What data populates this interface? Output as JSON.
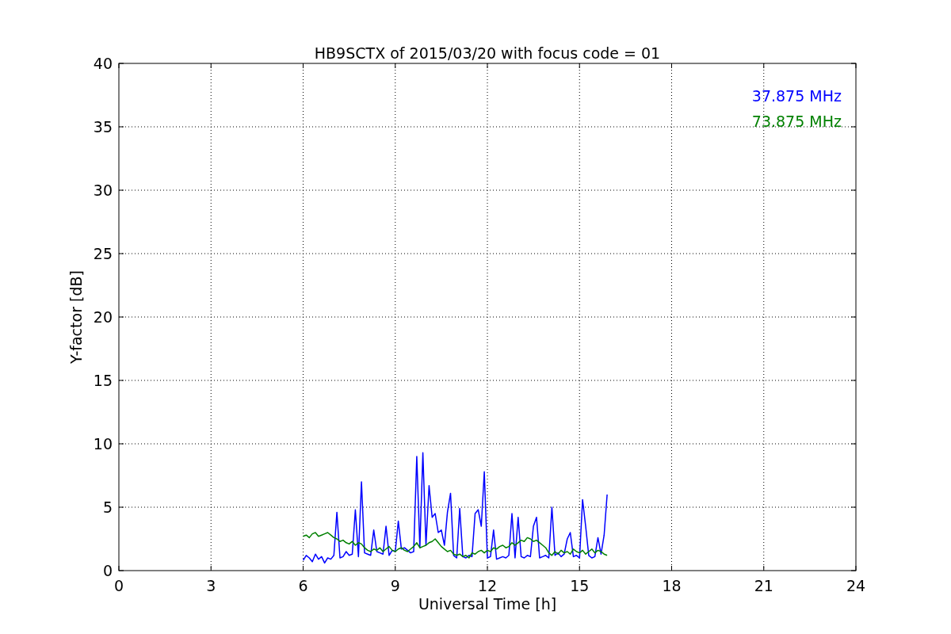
{
  "chart_data": {
    "type": "line",
    "grid": true,
    "title": "HB9SCTX of 2015/03/20 with focus code = 01",
    "xlabel": "Universal Time [h]",
    "ylabel": "Y-factor [dB]",
    "xlim": [
      0,
      24
    ],
    "ylim": [
      0,
      40
    ],
    "xticks": [
      0,
      3,
      6,
      9,
      12,
      15,
      18,
      21,
      24
    ],
    "yticks": [
      0,
      5,
      10,
      15,
      20,
      25,
      30,
      35,
      40
    ],
    "x": [
      6.0,
      6.1,
      6.2,
      6.3,
      6.4,
      6.5,
      6.6,
      6.7,
      6.8,
      6.9,
      7.0,
      7.1,
      7.2,
      7.3,
      7.4,
      7.5,
      7.6,
      7.7,
      7.8,
      7.9,
      8.0,
      8.1,
      8.2,
      8.3,
      8.4,
      8.5,
      8.6,
      8.7,
      8.8,
      8.9,
      9.0,
      9.1,
      9.2,
      9.3,
      9.4,
      9.5,
      9.6,
      9.7,
      9.8,
      9.9,
      10.0,
      10.1,
      10.2,
      10.3,
      10.4,
      10.5,
      10.6,
      10.7,
      10.8,
      10.9,
      11.0,
      11.1,
      11.2,
      11.3,
      11.4,
      11.5,
      11.6,
      11.7,
      11.8,
      11.9,
      12.0,
      12.1,
      12.2,
      12.3,
      12.4,
      12.5,
      12.6,
      12.7,
      12.8,
      12.9,
      13.0,
      13.1,
      13.2,
      13.3,
      13.4,
      13.5,
      13.6,
      13.7,
      13.8,
      13.9,
      14.0,
      14.1,
      14.2,
      14.3,
      14.4,
      14.5,
      14.6,
      14.7,
      14.8,
      14.9,
      15.0,
      15.1,
      15.2,
      15.3,
      15.4,
      15.5,
      15.6,
      15.7,
      15.8,
      15.9
    ],
    "series": [
      {
        "name": "37.875 MHz",
        "color": "#0000ff",
        "values": [
          0.8,
          1.2,
          1.0,
          0.7,
          1.3,
          0.9,
          1.1,
          0.6,
          1.0,
          0.9,
          1.2,
          4.6,
          1.0,
          1.1,
          1.5,
          1.2,
          1.3,
          4.8,
          1.1,
          7.0,
          1.4,
          1.3,
          1.2,
          3.2,
          1.5,
          1.4,
          1.3,
          3.5,
          1.2,
          1.6,
          1.5,
          3.9,
          1.7,
          1.8,
          1.6,
          1.4,
          1.5,
          9.0,
          1.8,
          9.3,
          2.0,
          6.7,
          4.2,
          4.5,
          3.0,
          3.2,
          2.0,
          4.6,
          6.1,
          1.2,
          1.0,
          4.9,
          1.1,
          1.0,
          1.2,
          1.1,
          4.5,
          4.8,
          3.5,
          7.8,
          1.0,
          1.1,
          3.2,
          0.9,
          1.0,
          1.1,
          1.0,
          1.2,
          4.5,
          1.0,
          4.2,
          1.1,
          1.0,
          1.2,
          1.1,
          3.5,
          4.2,
          1.0,
          1.1,
          1.2,
          1.0,
          5.0,
          1.2,
          1.4,
          1.1,
          1.3,
          2.5,
          3.0,
          1.1,
          1.2,
          1.0,
          5.6,
          3.5,
          1.2,
          1.0,
          1.1,
          2.6,
          1.3,
          2.8,
          6.0
        ]
      },
      {
        "name": "73.875 MHz",
        "color": "#008000",
        "values": [
          2.7,
          2.8,
          2.6,
          2.9,
          3.0,
          2.7,
          2.8,
          2.9,
          3.0,
          2.8,
          2.6,
          2.5,
          2.3,
          2.4,
          2.2,
          2.1,
          2.3,
          2.0,
          2.2,
          2.1,
          1.8,
          1.6,
          1.5,
          1.7,
          1.6,
          1.8,
          1.5,
          1.7,
          1.9,
          1.6,
          1.5,
          1.7,
          1.8,
          1.6,
          1.5,
          1.7,
          1.9,
          2.2,
          1.8,
          1.9,
          2.0,
          2.2,
          2.3,
          2.5,
          2.2,
          1.9,
          1.7,
          1.5,
          1.6,
          1.3,
          1.2,
          1.3,
          1.1,
          1.2,
          1.0,
          1.4,
          1.3,
          1.5,
          1.6,
          1.4,
          1.6,
          1.5,
          1.8,
          1.7,
          1.9,
          2.0,
          1.8,
          1.9,
          2.2,
          2.0,
          2.2,
          2.4,
          2.3,
          2.6,
          2.5,
          2.3,
          2.4,
          2.2,
          2.0,
          1.8,
          1.4,
          1.2,
          1.5,
          1.3,
          1.6,
          1.4,
          1.5,
          1.3,
          1.7,
          1.5,
          1.4,
          1.6,
          1.3,
          1.5,
          1.7,
          1.4,
          1.6,
          1.5,
          1.3,
          1.2
        ]
      }
    ]
  }
}
